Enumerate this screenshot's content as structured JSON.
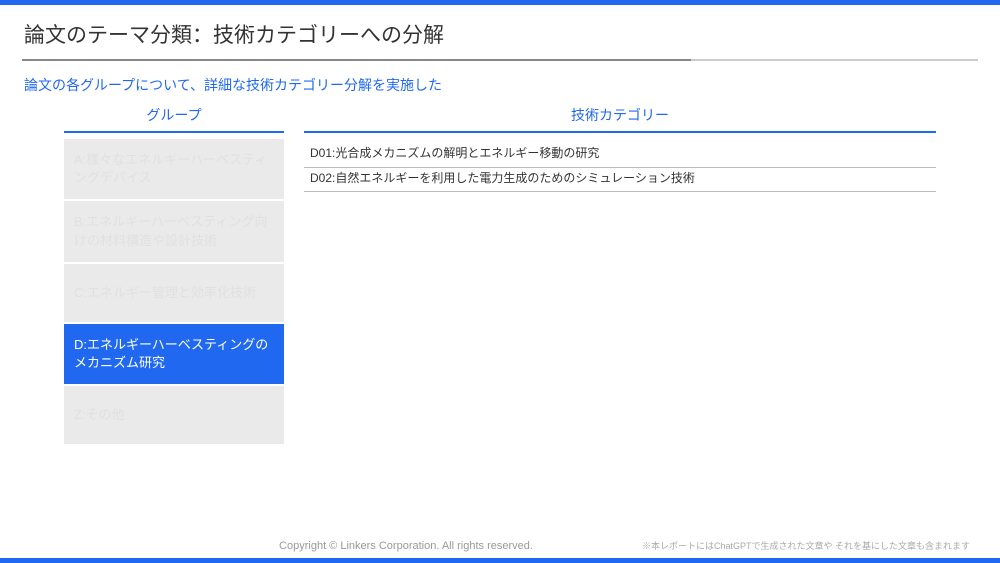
{
  "page": {
    "title": "論文のテーマ分類：技術カテゴリーへの分解",
    "subtitle": "論文の各グループについて、詳細な技術カテゴリー分解を実施した"
  },
  "columns": {
    "group_header": "グループ",
    "tech_header": "技術カテゴリー"
  },
  "groups": [
    {
      "label": "A:様々なエネルギーハーベスティングデバイス",
      "active": false
    },
    {
      "label": "B:エネルギーハーベスティング向けの材料構造や設計技術",
      "active": false
    },
    {
      "label": "C:エネルギー管理と効率化技術",
      "active": false
    },
    {
      "label": "D:エネルギーハーベスティングのメカニズム研究",
      "active": true
    },
    {
      "label": "Z:その他",
      "active": false
    }
  ],
  "tech_categories": [
    {
      "label": "D01:光合成メカニズムの解明とエネルギー移動の研究"
    },
    {
      "label": "D02:自然エネルギーを利用した電力生成のためのシミュレーション技術"
    }
  ],
  "footer": {
    "copyright": "Copyright © Linkers Corporation. All rights reserved.",
    "disclaimer": "※本レポートにはChatGPTで生成された文章や それを基にした文章も含まれます"
  }
}
